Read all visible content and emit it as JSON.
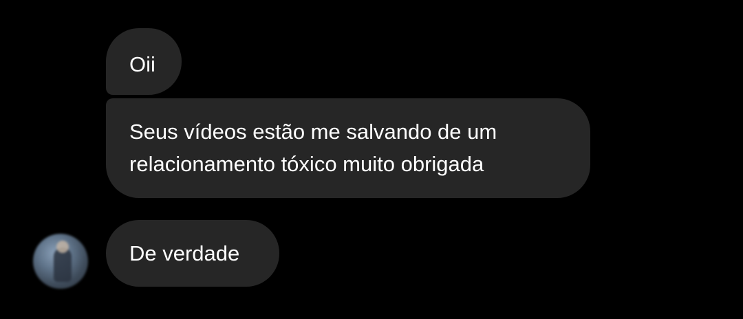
{
  "messages": [
    {
      "text": "Oii"
    },
    {
      "text": "Seus vídeos estão me salvando de um\nrelacionamento tóxico muito obrigada"
    },
    {
      "text": "De verdade"
    }
  ],
  "colors": {
    "background": "#000000",
    "bubble": "#262626",
    "text": "#ffffff"
  }
}
